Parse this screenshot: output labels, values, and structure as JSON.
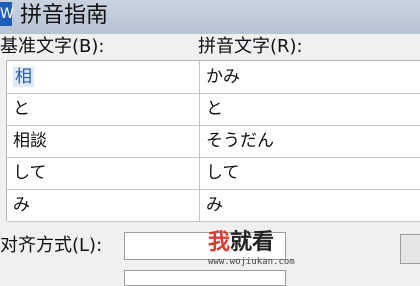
{
  "window": {
    "title": "拼音指南"
  },
  "headers": {
    "base_text": "基准文字(B):",
    "ruby_text": "拼音文字(R):"
  },
  "rows": [
    {
      "base": "相",
      "ruby": "かみ"
    },
    {
      "base": "と",
      "ruby": "と"
    },
    {
      "base": "相談",
      "ruby": "そうだん"
    },
    {
      "base": "して",
      "ruby": "して"
    },
    {
      "base": "み",
      "ruby": "み"
    }
  ],
  "alignment": {
    "label": "对齐方式(L):",
    "value": ""
  },
  "watermark": {
    "logo_red": "我",
    "logo_dark": "就看",
    "url": "www.wojiukan.com"
  },
  "colors": {
    "selection_text": "#2a5da8",
    "logo_red": "#e23a2e"
  }
}
